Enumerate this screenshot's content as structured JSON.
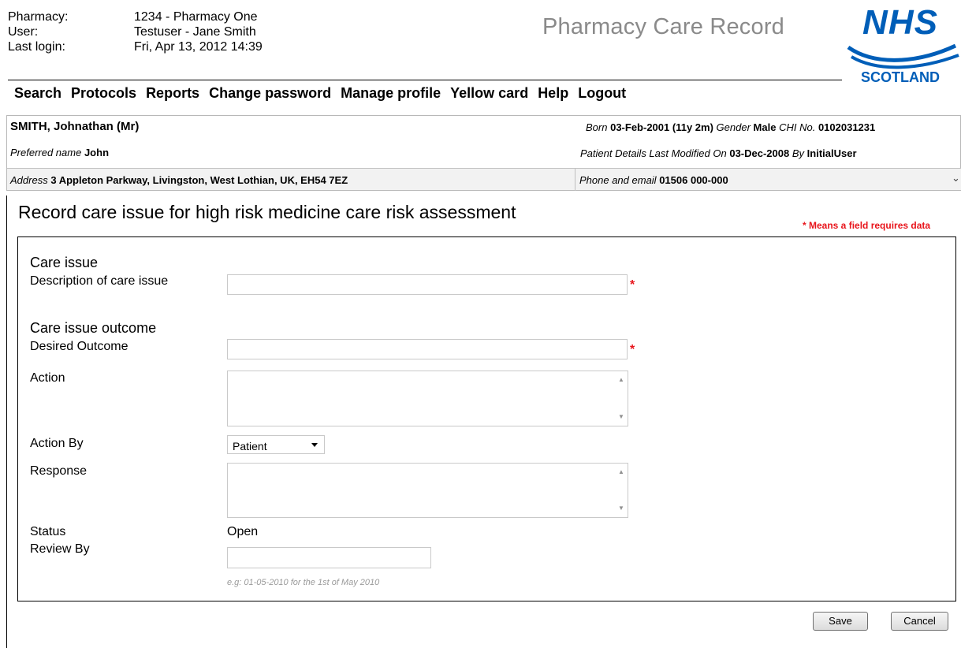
{
  "session": {
    "pharmacy_label": "Pharmacy:",
    "pharmacy_value": "1234 - Pharmacy One",
    "user_label": "User:",
    "user_value": "Testuser - Jane Smith",
    "login_label": "Last login:",
    "login_value": "Fri, Apr 13, 2012 14:39"
  },
  "app_title": "Pharmacy Care Record",
  "logo": {
    "main": "NHS",
    "sub": "SCOTLAND",
    "colors": {
      "brand": "#005eb8"
    }
  },
  "menu": [
    "Search",
    "Protocols",
    "Reports",
    "Change password",
    "Manage profile",
    "Yellow card",
    "Help",
    "Logout"
  ],
  "patient": {
    "name": "SMITH, Johnathan (Mr)",
    "born_label": "Born",
    "born_value": "03-Feb-2001",
    "age": "(11y 2m)",
    "gender_label": "Gender",
    "gender_value": "Male",
    "chi_label": "CHI No.",
    "chi_value": "0102031231",
    "preferred_label": "Preferred name",
    "preferred_value": "John",
    "modified_label": "Patient Details Last Modified On",
    "modified_value": "03-Dec-2008",
    "by_label": "By",
    "by_value": "InitialUser",
    "address_label": "Address",
    "address_value": "3 Appleton Parkway, Livingston, West Lothian, UK, EH54 7EZ",
    "phone_label": "Phone and email",
    "phone_value": "01506 000-000"
  },
  "form": {
    "title": "Record care issue for high risk medicine care risk assessment",
    "required_note": "* Means a field requires data",
    "care_issue_heading": "Care issue",
    "description_label": "Description of care issue",
    "description_value": "",
    "outcome_heading": "Care issue outcome",
    "desired_label": "Desired Outcome",
    "desired_value": "",
    "action_label": "Action",
    "action_value": "",
    "action_by_label": "Action By",
    "action_by_value": "Patient",
    "response_label": "Response",
    "response_value": "",
    "status_label": "Status",
    "status_value": "Open",
    "review_label": "Review By",
    "review_value": "",
    "review_hint": "e.g: 01-05-2010 for the 1st of May 2010",
    "required_marker": "*",
    "save_label": "Save",
    "cancel_label": "Cancel"
  },
  "icons": {
    "dropdown": "chevron-down-icon",
    "scroll_up": "triangle-up-icon",
    "scroll_down": "triangle-down-icon"
  },
  "colors": {
    "required": "#e8141b",
    "hint": "#9a9a9a",
    "title_grey": "#8a8a8a"
  }
}
